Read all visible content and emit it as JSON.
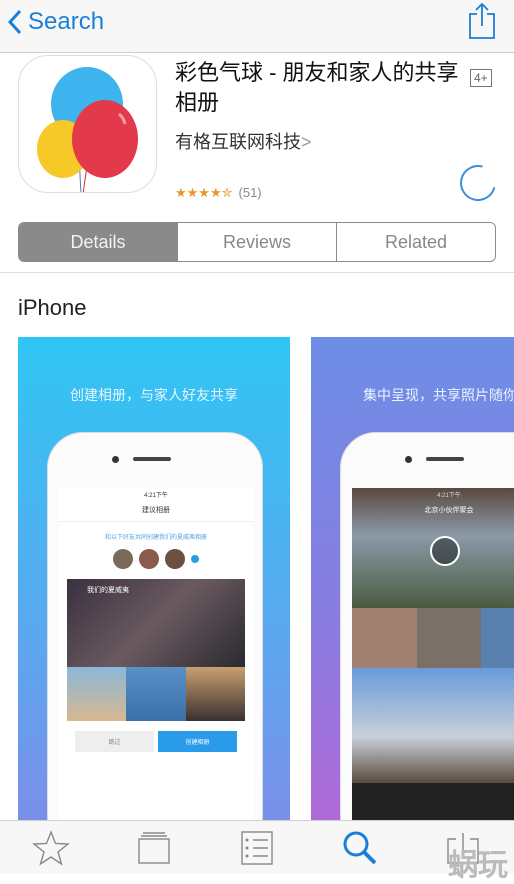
{
  "nav": {
    "back_label": "Search",
    "back_icon": "chevron-left-icon",
    "share_icon": "share-icon"
  },
  "app": {
    "title": "彩色气球 - 朋友和家人的共享相册",
    "age_rating": "4+",
    "developer": "有格互联网科技",
    "developer_chevron": ">",
    "rating_stars": 4.5,
    "rating_stars_text": "★★★★✮",
    "rating_count": "(51)"
  },
  "segments": [
    {
      "label": "Details",
      "selected": true
    },
    {
      "label": "Reviews",
      "selected": false
    },
    {
      "label": "Related",
      "selected": false
    }
  ],
  "section": {
    "platform": "iPhone"
  },
  "screenshots": [
    {
      "caption": "创建相册，与家人好友共享",
      "time": "4:21下午",
      "screen_title": "建议相册",
      "invite_text": "和以下好友共同创建我们的夏威夷相册",
      "album_title": "我们的夏威夷",
      "skip": "跳过",
      "create": "创建相册",
      "gradient": [
        "#2fc6f3",
        "#7a8fe8"
      ]
    },
    {
      "caption": "集中呈现，共享照片随你",
      "time": "4:21下午",
      "screen_title": "北京小伙伴聚会",
      "gradient": [
        "#6d8ee6",
        "#b06ad8"
      ]
    }
  ],
  "tabbar": [
    {
      "icon": "star-icon"
    },
    {
      "icon": "categories-icon"
    },
    {
      "icon": "top-charts-icon"
    },
    {
      "icon": "search-icon",
      "active": true
    },
    {
      "icon": "updates-icon"
    }
  ],
  "watermark": "蜗玩",
  "colors": {
    "accent": "#1a7fd6",
    "segment_selected": "#8a8a8a",
    "star": "#e8952a"
  }
}
